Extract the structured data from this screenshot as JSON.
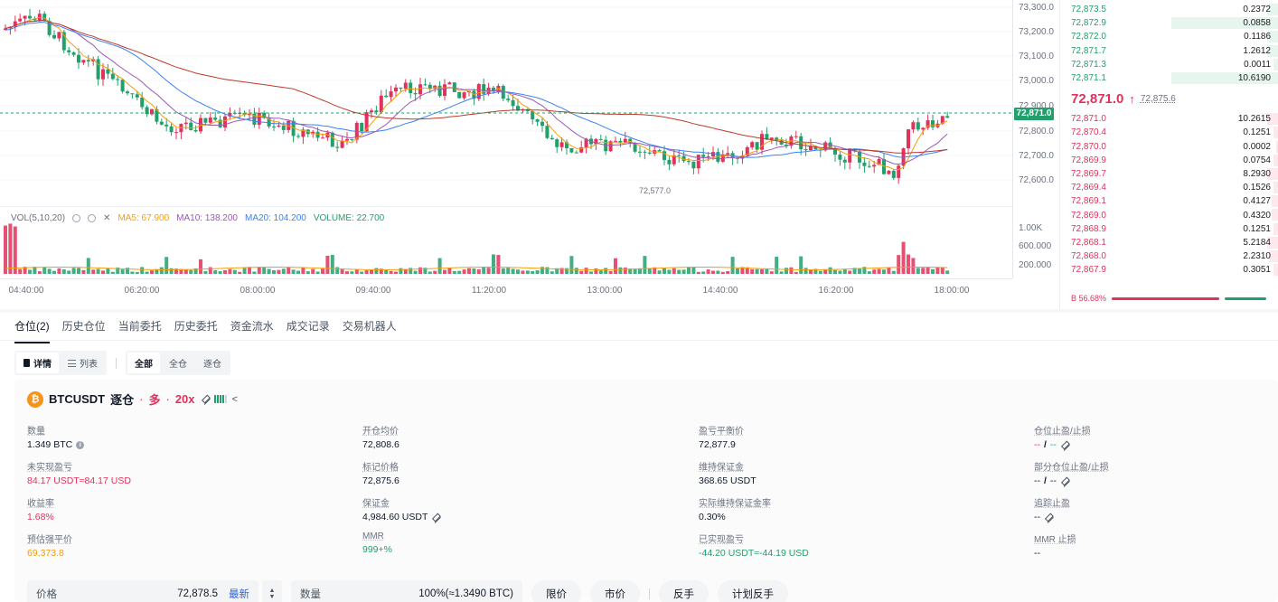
{
  "chart": {
    "price_ticks": [
      "73,300.0",
      "73,200.0",
      "73,100.0",
      "73,000.0",
      "72,900.0",
      "72,800.0",
      "72,700.0",
      "72,600.0"
    ],
    "volume_ticks": [
      "1.00K",
      "600.000",
      "200.000"
    ],
    "time_ticks": [
      "04:40:00",
      "06:20:00",
      "08:00:00",
      "09:40:00",
      "11:20:00",
      "13:00:00",
      "14:40:00",
      "16:20:00",
      "18:00:00"
    ],
    "current_price_tag": "72,871.0",
    "low_annotation": "72,577.0",
    "vol_legend": {
      "title": "VOL(5,10,20)",
      "ma5": "MA5: 67.900",
      "ma10": "MA10: 138.200",
      "ma20": "MA20: 104.200",
      "volume": "VOLUME: 22.700"
    },
    "colors": {
      "up": "#e0325b",
      "down": "#22a06b",
      "ma5": "#f59e0b",
      "ma10": "#9b59b6",
      "ma20": "#3b82f6",
      "ma_long": "#c0392b"
    }
  },
  "orderbook": {
    "asks": [
      {
        "price": "72,873.5",
        "size": "0.2372",
        "depth": 0.05
      },
      {
        "price": "72,872.9",
        "size": "0.0858",
        "depth": 0.49
      },
      {
        "price": "72,872.0",
        "size": "0.1186",
        "depth": 0.05
      },
      {
        "price": "72,871.7",
        "size": "1.2612",
        "depth": 0.05
      },
      {
        "price": "72,871.3",
        "size": "0.0011",
        "depth": 0.02
      },
      {
        "price": "72,871.1",
        "size": "10.6190",
        "depth": 0.49
      }
    ],
    "last_price": "72,871.0",
    "last_arrow": "↑",
    "mark_price": "72,875.6",
    "bids": [
      {
        "price": "72,871.0",
        "size": "10.2615",
        "depth": 0.05
      },
      {
        "price": "72,870.4",
        "size": "0.1251",
        "depth": 0.02
      },
      {
        "price": "72,870.0",
        "size": "0.0002",
        "depth": 0.01
      },
      {
        "price": "72,869.9",
        "size": "0.0754",
        "depth": 0.02
      },
      {
        "price": "72,869.7",
        "size": "8.2930",
        "depth": 0.05
      },
      {
        "price": "72,869.4",
        "size": "0.1526",
        "depth": 0.02
      },
      {
        "price": "72,869.1",
        "size": "0.4127",
        "depth": 0.03
      },
      {
        "price": "72,869.0",
        "size": "0.4320",
        "depth": 0.03
      },
      {
        "price": "72,868.9",
        "size": "0.1251",
        "depth": 0.02
      },
      {
        "price": "72,868.1",
        "size": "5.2184",
        "depth": 0.05
      },
      {
        "price": "72,868.0",
        "size": "2.2310",
        "depth": 0.04
      },
      {
        "price": "72,867.9",
        "size": "0.3051",
        "depth": 0.02
      }
    ],
    "ratio_label": "B 56.68%",
    "buy_ratio": 0.5668
  },
  "tabs": [
    {
      "label": "仓位(2)",
      "active": true
    },
    {
      "label": "历史仓位",
      "active": false
    },
    {
      "label": "当前委托",
      "active": false
    },
    {
      "label": "历史委托",
      "active": false
    },
    {
      "label": "资金流水",
      "active": false
    },
    {
      "label": "成交记录",
      "active": false
    },
    {
      "label": "交易机器人",
      "active": false
    }
  ],
  "filters": {
    "view": {
      "detail": "详情",
      "list": "列表"
    },
    "margin": {
      "all": "全部",
      "cross": "全仓",
      "isolated": "逐仓"
    }
  },
  "position": {
    "coin_glyph": "₿",
    "symbol": "BTCUSDT",
    "mode": "逐仓",
    "dot": "·",
    "side": "多",
    "leverage": "20x",
    "fields": {
      "quantity": {
        "label": "数量",
        "value": "1.349 BTC"
      },
      "entry_price": {
        "label": "开仓均价",
        "value": "72,808.6"
      },
      "breakeven_price": {
        "label": "盈亏平衡价",
        "value": "72,877.9"
      },
      "tpsl_position": {
        "label": "仓位止盈/止损",
        "value_a": "--",
        "value_b": "--"
      },
      "unrealized_pnl": {
        "label": "未实现盈亏",
        "value": "84.17 USDT≈84.17 USD"
      },
      "mark_price": {
        "label": "标记价格",
        "value": "72,875.6"
      },
      "maint_margin": {
        "label": "维持保证金",
        "value": "368.65 USDT"
      },
      "tpsl_partial": {
        "label": "部分仓位止盈/止损",
        "value_a": "--",
        "value_b": "--"
      },
      "roe": {
        "label": "收益率",
        "value": "1.68%"
      },
      "margin": {
        "label": "保证金",
        "value": "4,984.60 USDT"
      },
      "maint_margin_rate": {
        "label": "实际维持保证金率",
        "value": "0.30%"
      },
      "trailing_stop": {
        "label": "追踪止盈",
        "value": "--"
      },
      "liq_price": {
        "label": "预估强平价",
        "value": "69,373.8"
      },
      "mmr": {
        "label": "MMR",
        "value": "999+%"
      },
      "realized_pnl": {
        "label": "已实现盈亏",
        "value": "-44.20 USDT≈-44.19 USD"
      },
      "mmr_stop": {
        "label": "MMR 止损",
        "value": "--"
      }
    }
  },
  "order_row": {
    "price_label": "价格",
    "price_value": "72,878.5",
    "latest": "最新",
    "qty_label": "数量",
    "qty_value": "100%(≈1.3490 BTC)",
    "btn_limit": "限价",
    "btn_market": "市价",
    "btn_reverse": "反手",
    "btn_plan_reverse": "计划反手"
  }
}
